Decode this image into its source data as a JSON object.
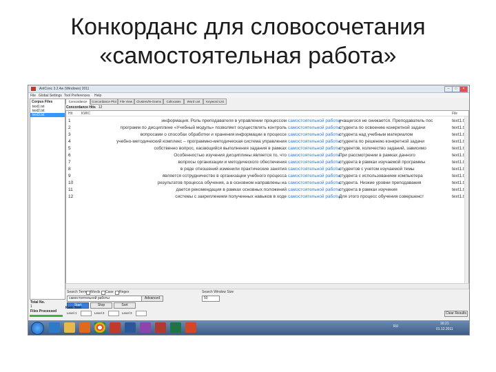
{
  "slide": {
    "title_line1": "Конкорданс для словосочетания",
    "title_line2": "«самостоятельная работа»"
  },
  "window": {
    "title": "AntConc 3.2.4w (Windows) 2011",
    "buttons": [
      "–",
      "□",
      "×"
    ]
  },
  "menu": [
    "File",
    "Global Settings",
    "Tool Preferences",
    "Help"
  ],
  "corpus_files": {
    "label": "Corpus Files",
    "files": [
      "text1.txt",
      "text2.txt",
      "text3.txt"
    ],
    "selected_index": 2
  },
  "tabs": [
    "Concordance",
    "Concordance Plot",
    "File View",
    "Clusters/N-Grams",
    "Collocates",
    "Word List",
    "Keyword List"
  ],
  "active_tab_index": 0,
  "concordance_hits": {
    "label": "Concordance Hits",
    "value": "12"
  },
  "table_headers": {
    "hit": "Hit",
    "kwic": "KWIC",
    "file": "File"
  },
  "rows": [
    {
      "num": "1",
      "left": "информация. Роль преподавателя в управлении процессом",
      "hit": "самостоятельной работы",
      "right": "учащегося не снижается. Преподаватель пос",
      "file": "text1.txt"
    },
    {
      "num": "2",
      "left": "программ по дисциплине «Учебный модуль» позволяет осуществлять контроль",
      "hit": "самостоятельной работы",
      "right": "студента по освоению конкретной задачи",
      "file": "text1.txt"
    },
    {
      "num": "3",
      "left": "вопросами о способах обработки и хранения информации в процессе",
      "hit": "самостоятельной работы",
      "right": "студента над учебным материалом",
      "file": "text1.txt"
    },
    {
      "num": "4",
      "left": "учебно-методический комплекс – программно-методическая система управления",
      "hit": "самостоятельной работы",
      "right": "студента по решению конкретной задачи",
      "file": "text1.txt"
    },
    {
      "num": "5",
      "left": "собственно вопрос, касающийся выполнения задания в рамках",
      "hit": "самостоятельной работы",
      "right": "студентов, количество заданий, зависимо",
      "file": "text1.txt"
    },
    {
      "num": "6",
      "left": "Особенностью изучения дисциплины является то, что",
      "hit": "самостоятельной работы",
      "right": "При рассмотрении в рамках данного",
      "file": "text1.txt"
    },
    {
      "num": "7",
      "left": "вопросы организации и методического обеспечения",
      "hit": "самостоятельной работы",
      "right": "студента в рамках изучаемой программы",
      "file": "text1.txt"
    },
    {
      "num": "8",
      "left": "в ряде отношений изменили практические занятия",
      "hit": "самостоятельной работы",
      "right": "студентов с учетом изучаемой темы",
      "file": "text1.txt"
    },
    {
      "num": "9",
      "left": "является сотрудничество в организации учебного процесса",
      "hit": "самостоятельной работы",
      "right": "студента с использованием компьютера",
      "file": "text1.txt"
    },
    {
      "num": "10",
      "left": "результатов процесса обучения, а в основном направлены на",
      "hit": "самостоятельной работы",
      "right": "студента. Низкие уровни преподавания",
      "file": "text1.txt"
    },
    {
      "num": "11",
      "left": "дается рекомендация в рамках основных положений",
      "hit": "самостоятельной работы",
      "right": "студента в рамках изучения",
      "file": "text1.txt"
    },
    {
      "num": "12",
      "left": "системы с закреплением полученных навыков в ходе",
      "hit": "самостоятельной работы",
      "right": "Для этого процесс обучения совершенст",
      "file": "text1.txt"
    }
  ],
  "search": {
    "term_label": "Search Term",
    "words_label": "Words",
    "case_label": "Case",
    "regex_label": "Regex",
    "value": "самостоятельной работы",
    "advanced": "Advanced",
    "search_window_label": "Search Window Size",
    "search_window_value": "50",
    "start": "Start",
    "stop": "Stop",
    "sort": "Sort"
  },
  "left_bottom": {
    "total_label": "Total No.",
    "total_value": "1",
    "files_processed": "Files Processed"
  },
  "progress_fraction": 1.0,
  "kwic_sort": {
    "label": "Kwic Sort",
    "level1": "Level 1",
    "level2": "Level 2",
    "level3": "Level 3",
    "clear": "Clear Results"
  },
  "tray": {
    "lang": "RU",
    "time": "16:21",
    "date": "01.12.2011"
  },
  "colors": {
    "hit": "#2a7ad5",
    "selected": "#3399ff",
    "progress": "#3cb043",
    "taskbar": "#3c5b86"
  },
  "taskbar_icons": [
    "start-orb-icon",
    "ie-icon",
    "folder-icon",
    "media-player-icon",
    "chrome-icon",
    "antconc-icon",
    "word-icon",
    "paint-icon",
    "pdf-icon",
    "excel-icon",
    "powerpoint-icon"
  ]
}
